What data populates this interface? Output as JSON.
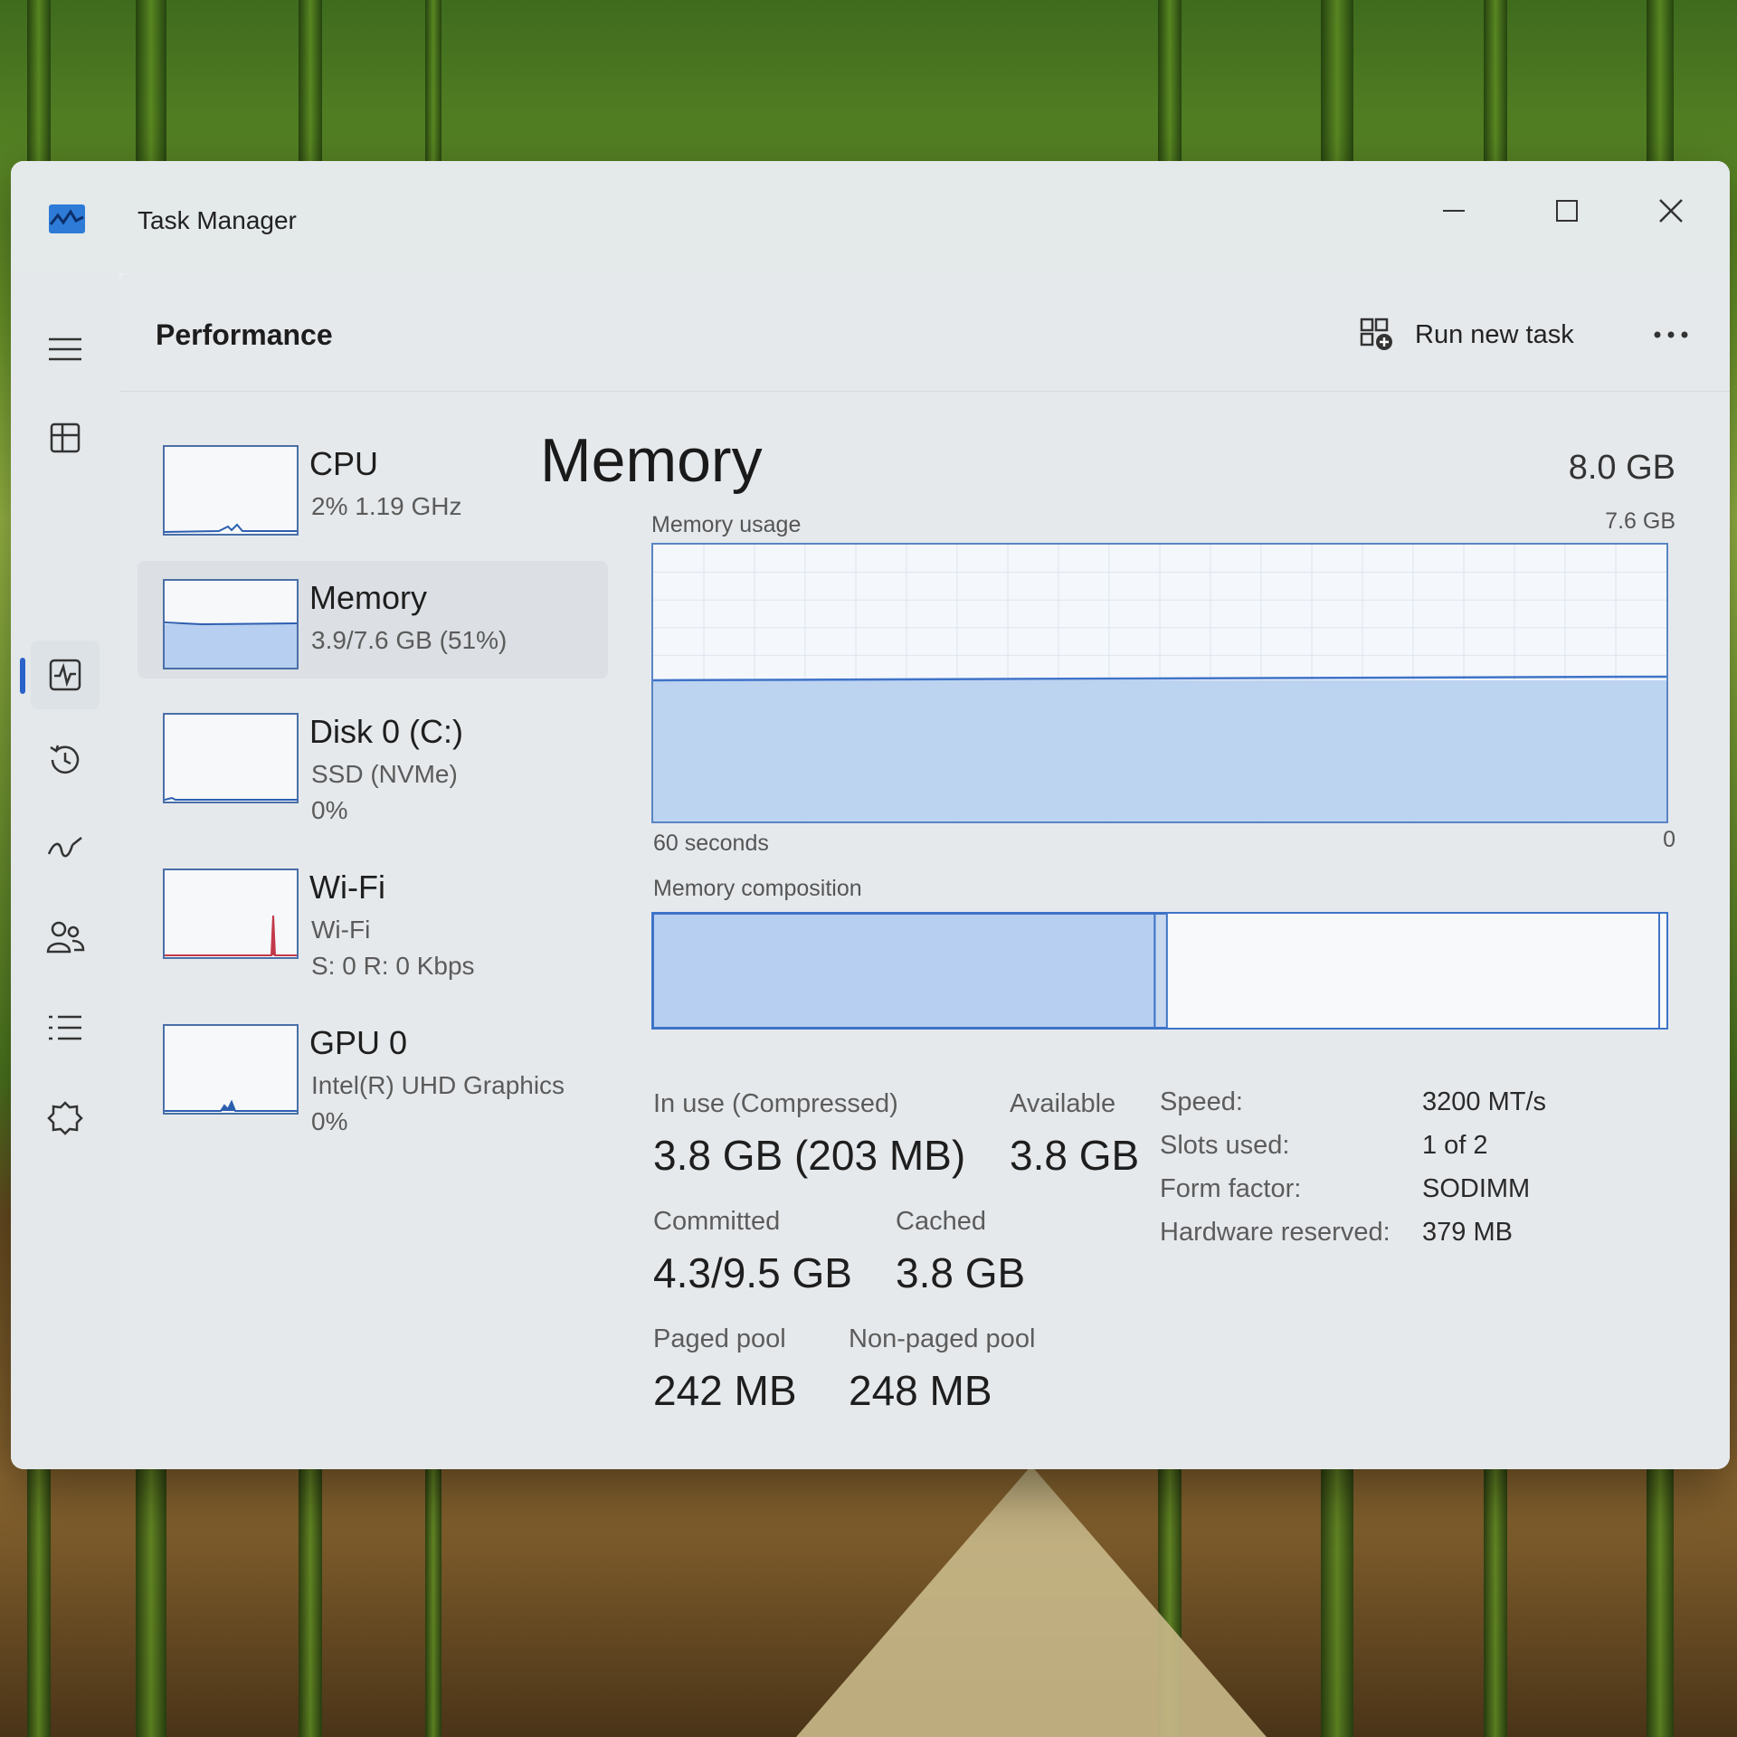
{
  "window": {
    "title": "Task Manager"
  },
  "header": {
    "page_title": "Performance",
    "run_new_task": "Run new task"
  },
  "resources": [
    {
      "name": "CPU",
      "line1": "2%  1.19 GHz",
      "line2": ""
    },
    {
      "name": "Memory",
      "line1": "3.9/7.6 GB (51%)",
      "line2": ""
    },
    {
      "name": "Disk 0 (C:)",
      "line1": "SSD (NVMe)",
      "line2": "0%"
    },
    {
      "name": "Wi-Fi",
      "line1": "Wi-Fi",
      "line2": "S: 0 R: 0 Kbps"
    },
    {
      "name": "GPU 0",
      "line1": "Intel(R) UHD Graphics",
      "line2": "0%"
    }
  ],
  "detail": {
    "title": "Memory",
    "total": "8.0 GB",
    "usage_label": "Memory usage",
    "usage_max": "7.6 GB",
    "time_span": "60 seconds",
    "time_zero": "0",
    "composition_label": "Memory composition",
    "usage_fraction": 0.51,
    "composition": {
      "in_use_fraction": 0.495,
      "modified_fraction": 0.012
    }
  },
  "stats": {
    "in_use_label": "In use (Compressed)",
    "in_use_value": "3.8 GB (203 MB)",
    "available_label": "Available",
    "available_value": "3.8 GB",
    "committed_label": "Committed",
    "committed_value": "4.3/9.5 GB",
    "cached_label": "Cached",
    "cached_value": "3.8 GB",
    "paged_label": "Paged pool",
    "paged_value": "242 MB",
    "nonpaged_label": "Non-paged pool",
    "nonpaged_value": "248 MB"
  },
  "properties": [
    {
      "label": "Speed:",
      "value": "3200 MT/s"
    },
    {
      "label": "Slots used:",
      "value": "1 of 2"
    },
    {
      "label": "Form factor:",
      "value": "SODIMM"
    },
    {
      "label": "Hardware reserved:",
      "value": "379 MB"
    }
  ],
  "colors": {
    "accent": "#2a62c9",
    "graph_fill": "#b7cff0",
    "graph_line": "#3f73c8",
    "wifi_spike": "#c23a4a"
  },
  "icons": [
    "hamburger-icon",
    "processes-icon",
    "performance-icon",
    "app-history-icon",
    "startup-apps-icon",
    "users-icon",
    "details-icon",
    "services-icon",
    "settings-icon",
    "run-task-icon",
    "more-icon",
    "minimize-icon",
    "maximize-icon",
    "close-icon"
  ]
}
